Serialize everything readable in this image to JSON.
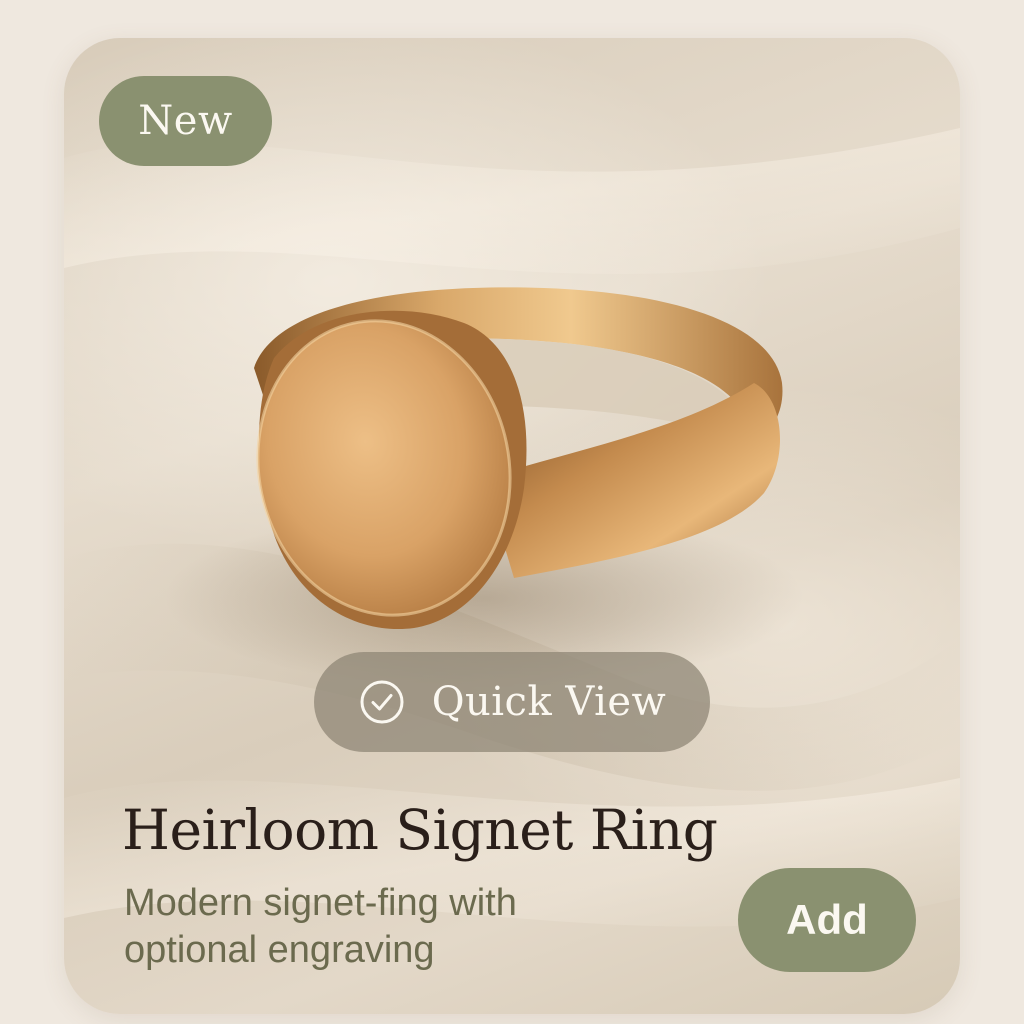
{
  "badge": {
    "label": "New"
  },
  "quick_view": {
    "label": "Quick View",
    "icon": "check-circle-icon"
  },
  "product": {
    "title": "Heirloom Signet Ring",
    "description": "Modern signet-fing with optional engraving",
    "image": "gold-signet-ring-photo"
  },
  "actions": {
    "add_label": "Add"
  },
  "colors": {
    "accent": "#8a9170",
    "background": "#efe8df",
    "title": "#2a1f1a",
    "description": "#6b6a4e",
    "gold": "#c99a5e"
  }
}
